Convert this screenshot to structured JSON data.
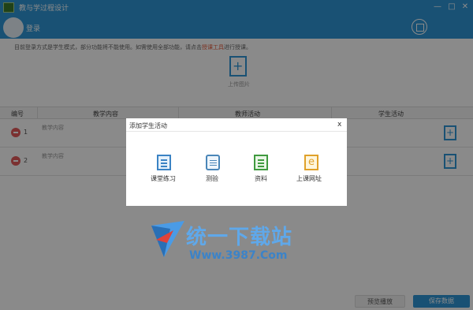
{
  "app": {
    "title": "教与学过程设计"
  },
  "window_controls": {
    "minimize": "—",
    "maximize": "□",
    "close": "✕"
  },
  "header": {
    "login": "登录"
  },
  "notice": {
    "before": "目前登录方式是学生模式，部分功能将不能使用。如需使用全部功能，请点击",
    "link": "授课工具",
    "after": "进行授课。"
  },
  "upload": {
    "label": "上传图片"
  },
  "table": {
    "headers": [
      "编号",
      "教学内容",
      "教师活动",
      "学生活动"
    ],
    "rows": [
      {
        "num": "1",
        "content": "教学内容"
      },
      {
        "num": "2",
        "content": "教学内容"
      }
    ]
  },
  "buttons": {
    "reset": "预览播放",
    "save": "保存数据"
  },
  "dialog": {
    "title": "添加学生活动",
    "close": "x",
    "options": [
      {
        "label": "课堂练习",
        "icon": "practice-icon"
      },
      {
        "label": "测验",
        "icon": "test-icon"
      },
      {
        "label": "资料",
        "icon": "data-icon"
      },
      {
        "label": "上课网址",
        "icon": "url-icon",
        "glyph": "e"
      }
    ]
  },
  "watermark": {
    "cn": "统一下载站",
    "url": "Www.3987.Com"
  },
  "colors": {
    "accent": "#2f97d7",
    "danger": "#e35b5b"
  }
}
